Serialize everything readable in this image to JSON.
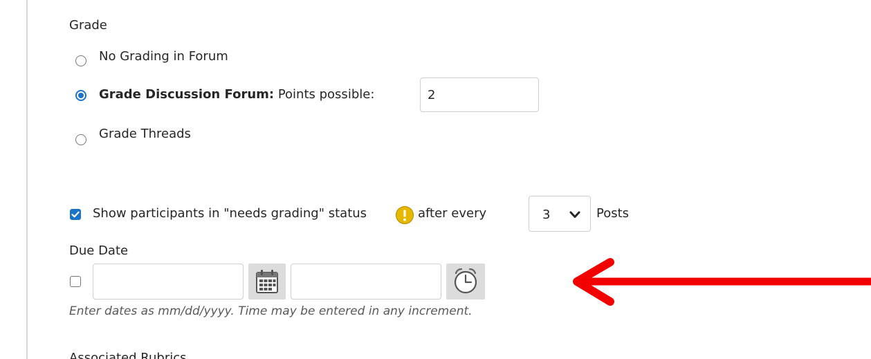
{
  "grade_section": {
    "heading": "Grade",
    "options": [
      {
        "label": "No Grading in Forum",
        "selected": false
      },
      {
        "label_bold": "Grade Discussion Forum:",
        "label_rest": "Points possible:",
        "selected": true
      },
      {
        "label": "Grade Threads",
        "selected": false
      }
    ],
    "points_possible_value": "2"
  },
  "needs_grading": {
    "checked": true,
    "label_before": "Show participants in \"needs grading\" status",
    "label_after": "after every",
    "posts_value": "3",
    "posts_label": "Posts",
    "info_icon": "warning-circle-icon"
  },
  "due_date": {
    "heading": "Due Date",
    "checked": false,
    "date_value": "",
    "time_value": "",
    "help_text": "Enter dates as mm/dd/yyyy. Time may be entered in any increment.",
    "calendar_icon": "calendar-icon",
    "clock_icon": "clock-icon"
  },
  "annotation": {
    "arrow_color": "#f20000",
    "arrow_icon": "left-arrow-icon"
  },
  "associated_rubrics_heading": "Associated Rubrics",
  "colors": {
    "accent": "#1a73c8",
    "info_icon": "#e6b800"
  }
}
